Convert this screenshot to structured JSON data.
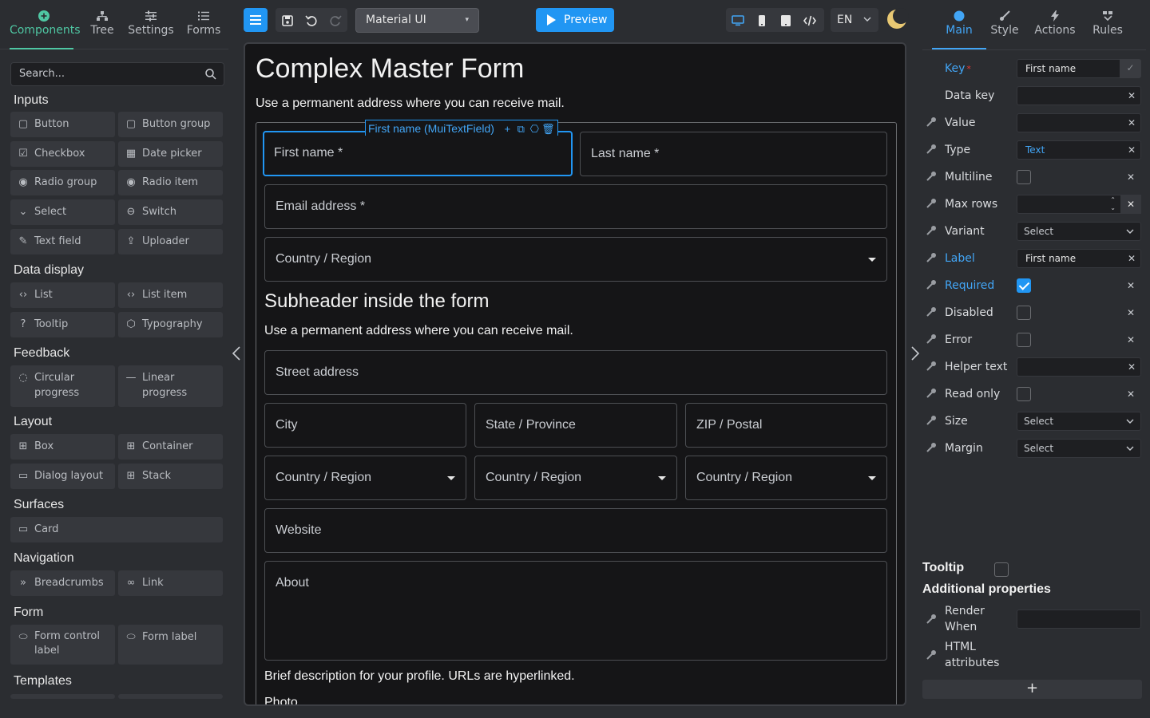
{
  "left": {
    "tabs": [
      {
        "label": "Components",
        "icon": "plus-circle-icon"
      },
      {
        "label": "Tree",
        "icon": "tree-icon"
      },
      {
        "label": "Settings",
        "icon": "sliders-icon"
      },
      {
        "label": "Forms",
        "icon": "list-icon"
      }
    ],
    "search_placeholder": "Search...",
    "categories": [
      {
        "title": "Inputs",
        "items": [
          "Button",
          "Button group",
          "Checkbox",
          "Date picker",
          "Radio group",
          "Radio item",
          "Select",
          "Switch",
          "Text field",
          "Uploader"
        ]
      },
      {
        "title": "Data display",
        "items": [
          "List",
          "List item",
          "Tooltip",
          "Typography"
        ]
      },
      {
        "title": "Feedback",
        "items": [
          "Circular progress",
          "Linear progress"
        ]
      },
      {
        "title": "Layout",
        "items": [
          "Box",
          "Container",
          "Dialog layout",
          "Stack"
        ]
      },
      {
        "title": "Surfaces",
        "items": [
          "Card"
        ]
      },
      {
        "title": "Navigation",
        "items": [
          "Breadcrumbs",
          "Link"
        ]
      },
      {
        "title": "Form",
        "items": [
          "Form control label",
          "Form label"
        ]
      },
      {
        "title": "Templates",
        "items": []
      }
    ]
  },
  "toolbar": {
    "library": "Material UI",
    "preview_label": "Preview",
    "language": "EN",
    "accent": "#2196f3"
  },
  "form": {
    "title": "Complex Master Form",
    "subtitle": "Use a permanent address where you can receive mail.",
    "selected_chip": "First name (MuiTextField)",
    "fields": {
      "first_name": "First name *",
      "last_name": "Last name *",
      "email": "Email address *",
      "country1": "Country / Region",
      "street": "Street address",
      "city": "City",
      "state": "State / Province",
      "zip": "ZIP / Postal",
      "country2": "Country / Region",
      "country3": "Country / Region",
      "country4": "Country / Region",
      "website": "Website",
      "about": "About"
    },
    "subheader": "Subheader inside the form",
    "subheader_text": "Use a permanent address where you can receive mail.",
    "about_help": "Brief description for your profile. URLs are hyperlinked.",
    "photo_label": "Photo"
  },
  "right": {
    "tabs": [
      {
        "label": "Main",
        "icon": "circle-icon"
      },
      {
        "label": "Style",
        "icon": "brush-icon"
      },
      {
        "label": "Actions",
        "icon": "bolt-icon"
      },
      {
        "label": "Rules",
        "icon": "rules-icon"
      }
    ],
    "props": {
      "key": {
        "label": "Key",
        "value": "First name"
      },
      "data_key": {
        "label": "Data key",
        "value": ""
      },
      "value": {
        "label": "Value",
        "value": ""
      },
      "type": {
        "label": "Type",
        "value": "Text"
      },
      "multiline": {
        "label": "Multiline"
      },
      "max_rows": {
        "label": "Max rows",
        "value": ""
      },
      "variant": {
        "label": "Variant",
        "value": "Select"
      },
      "label": {
        "label": "Label",
        "value": "First name"
      },
      "required": {
        "label": "Required",
        "checked": true
      },
      "disabled": {
        "label": "Disabled"
      },
      "error": {
        "label": "Error"
      },
      "helper_text": {
        "label": "Helper text",
        "value": ""
      },
      "read_only": {
        "label": "Read only"
      },
      "size": {
        "label": "Size",
        "value": "Select"
      },
      "margin": {
        "label": "Margin",
        "value": "Select"
      }
    },
    "tooltip_label": "Tooltip",
    "additional_title": "Additional properties",
    "render_when": "Render When",
    "html_attributes": "HTML attributes",
    "add_label": "+"
  }
}
